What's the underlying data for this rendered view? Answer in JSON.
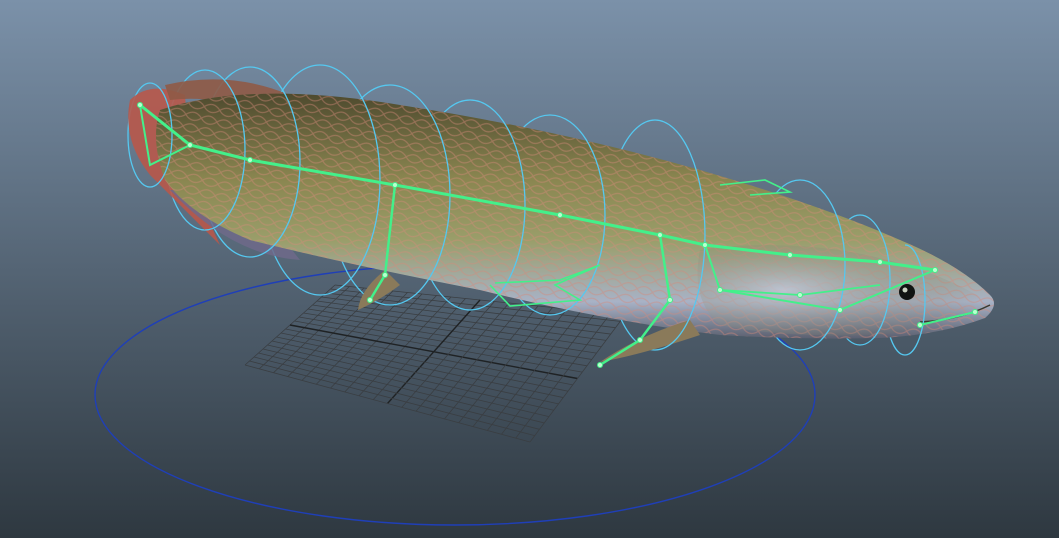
{
  "viewport": {
    "background_top": "#7b91a9",
    "background_bottom": "#2e3840"
  },
  "grid": {
    "color": "#3a3e42",
    "axis_color": "#1f2224",
    "divisions": 20
  },
  "ground_controller": {
    "color": "#1f3fb8"
  },
  "body_controls": {
    "color": "#55c8f0",
    "ring_count": 11
  },
  "skeleton": {
    "color": "#43f08a",
    "joint_fill": "#b9ffcf"
  },
  "fish": {
    "body_light": "#9a9e6a",
    "body_mid": "#7d7a4a",
    "body_dark": "#4e4a2e",
    "scale_tint": "#d58a7a",
    "belly": "#a8b2c6",
    "tail_red": "#b8584a",
    "eye": "#101412"
  }
}
